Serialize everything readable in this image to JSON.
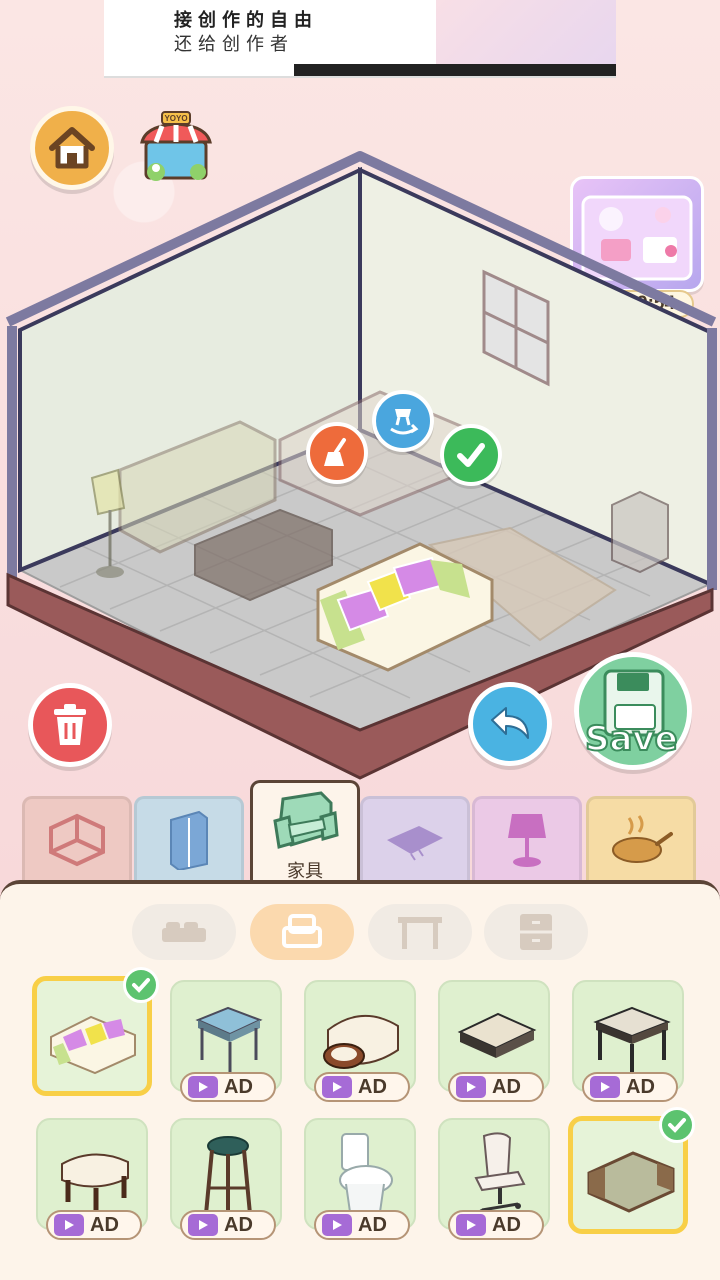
{
  "banner": {
    "line1": "接创作的自由",
    "line2": "还给创作者"
  },
  "buttons": {
    "home": "home",
    "shop_sign": "YOYO",
    "save_label": "Save"
  },
  "gift": {
    "timer": "23:59:54"
  },
  "tabs": [
    {
      "name": "room-shell",
      "icon": "cube-icon"
    },
    {
      "name": "cabinet",
      "icon": "wardrobe-icon"
    },
    {
      "name": "furniture",
      "icon": "armchair-icon",
      "label": "家具"
    },
    {
      "name": "rug",
      "icon": "rug-icon"
    },
    {
      "name": "lamp",
      "icon": "lamp-icon"
    },
    {
      "name": "kitchen",
      "icon": "pan-icon"
    }
  ],
  "subtabs": [
    "bed-icon",
    "armchair-icon",
    "table-icon",
    "drawer-icon"
  ],
  "items": {
    "ad_label": "AD",
    "row1": [
      {
        "name": "floral-sofa",
        "selected": true
      },
      {
        "name": "blue-side-table",
        "ad": true
      },
      {
        "name": "cream-armchair",
        "ad": true
      },
      {
        "name": "square-ottoman",
        "ad": true
      },
      {
        "name": "dark-coffee-table",
        "ad": true
      }
    ],
    "row2": [
      {
        "name": "footstool",
        "ad": true
      },
      {
        "name": "bar-stool",
        "ad": true
      },
      {
        "name": "toilet",
        "ad": true
      },
      {
        "name": "office-chair",
        "ad": true
      },
      {
        "name": "green-sofa",
        "selected": true
      }
    ]
  }
}
